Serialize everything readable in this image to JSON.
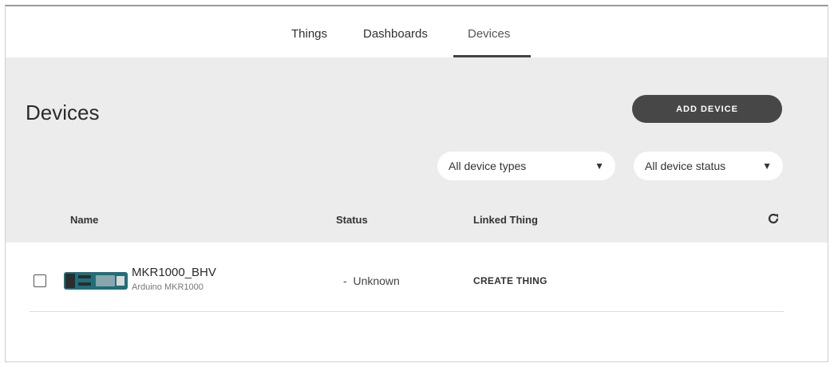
{
  "nav": {
    "tabs": [
      {
        "label": "Things"
      },
      {
        "label": "Dashboards"
      },
      {
        "label": "Devices"
      }
    ]
  },
  "header": {
    "title": "Devices",
    "add_button": "ADD DEVICE",
    "filters": {
      "type_selected": "All device types",
      "status_selected": "All device status"
    }
  },
  "table": {
    "columns": {
      "name": "Name",
      "status": "Status",
      "linked": "Linked Thing"
    },
    "rows": [
      {
        "name": "MKR1000_BHV",
        "type": "Arduino MKR1000",
        "status": "Unknown",
        "status_prefix": "-",
        "action": "CREATE THING"
      }
    ]
  },
  "colors": {
    "accent_dark": "#474747",
    "header_band": "#ececec",
    "board_teal": "#1f6f7a"
  },
  "icons": [
    "refresh-icon",
    "chevron-down-icon",
    "board-thumbnail"
  ]
}
